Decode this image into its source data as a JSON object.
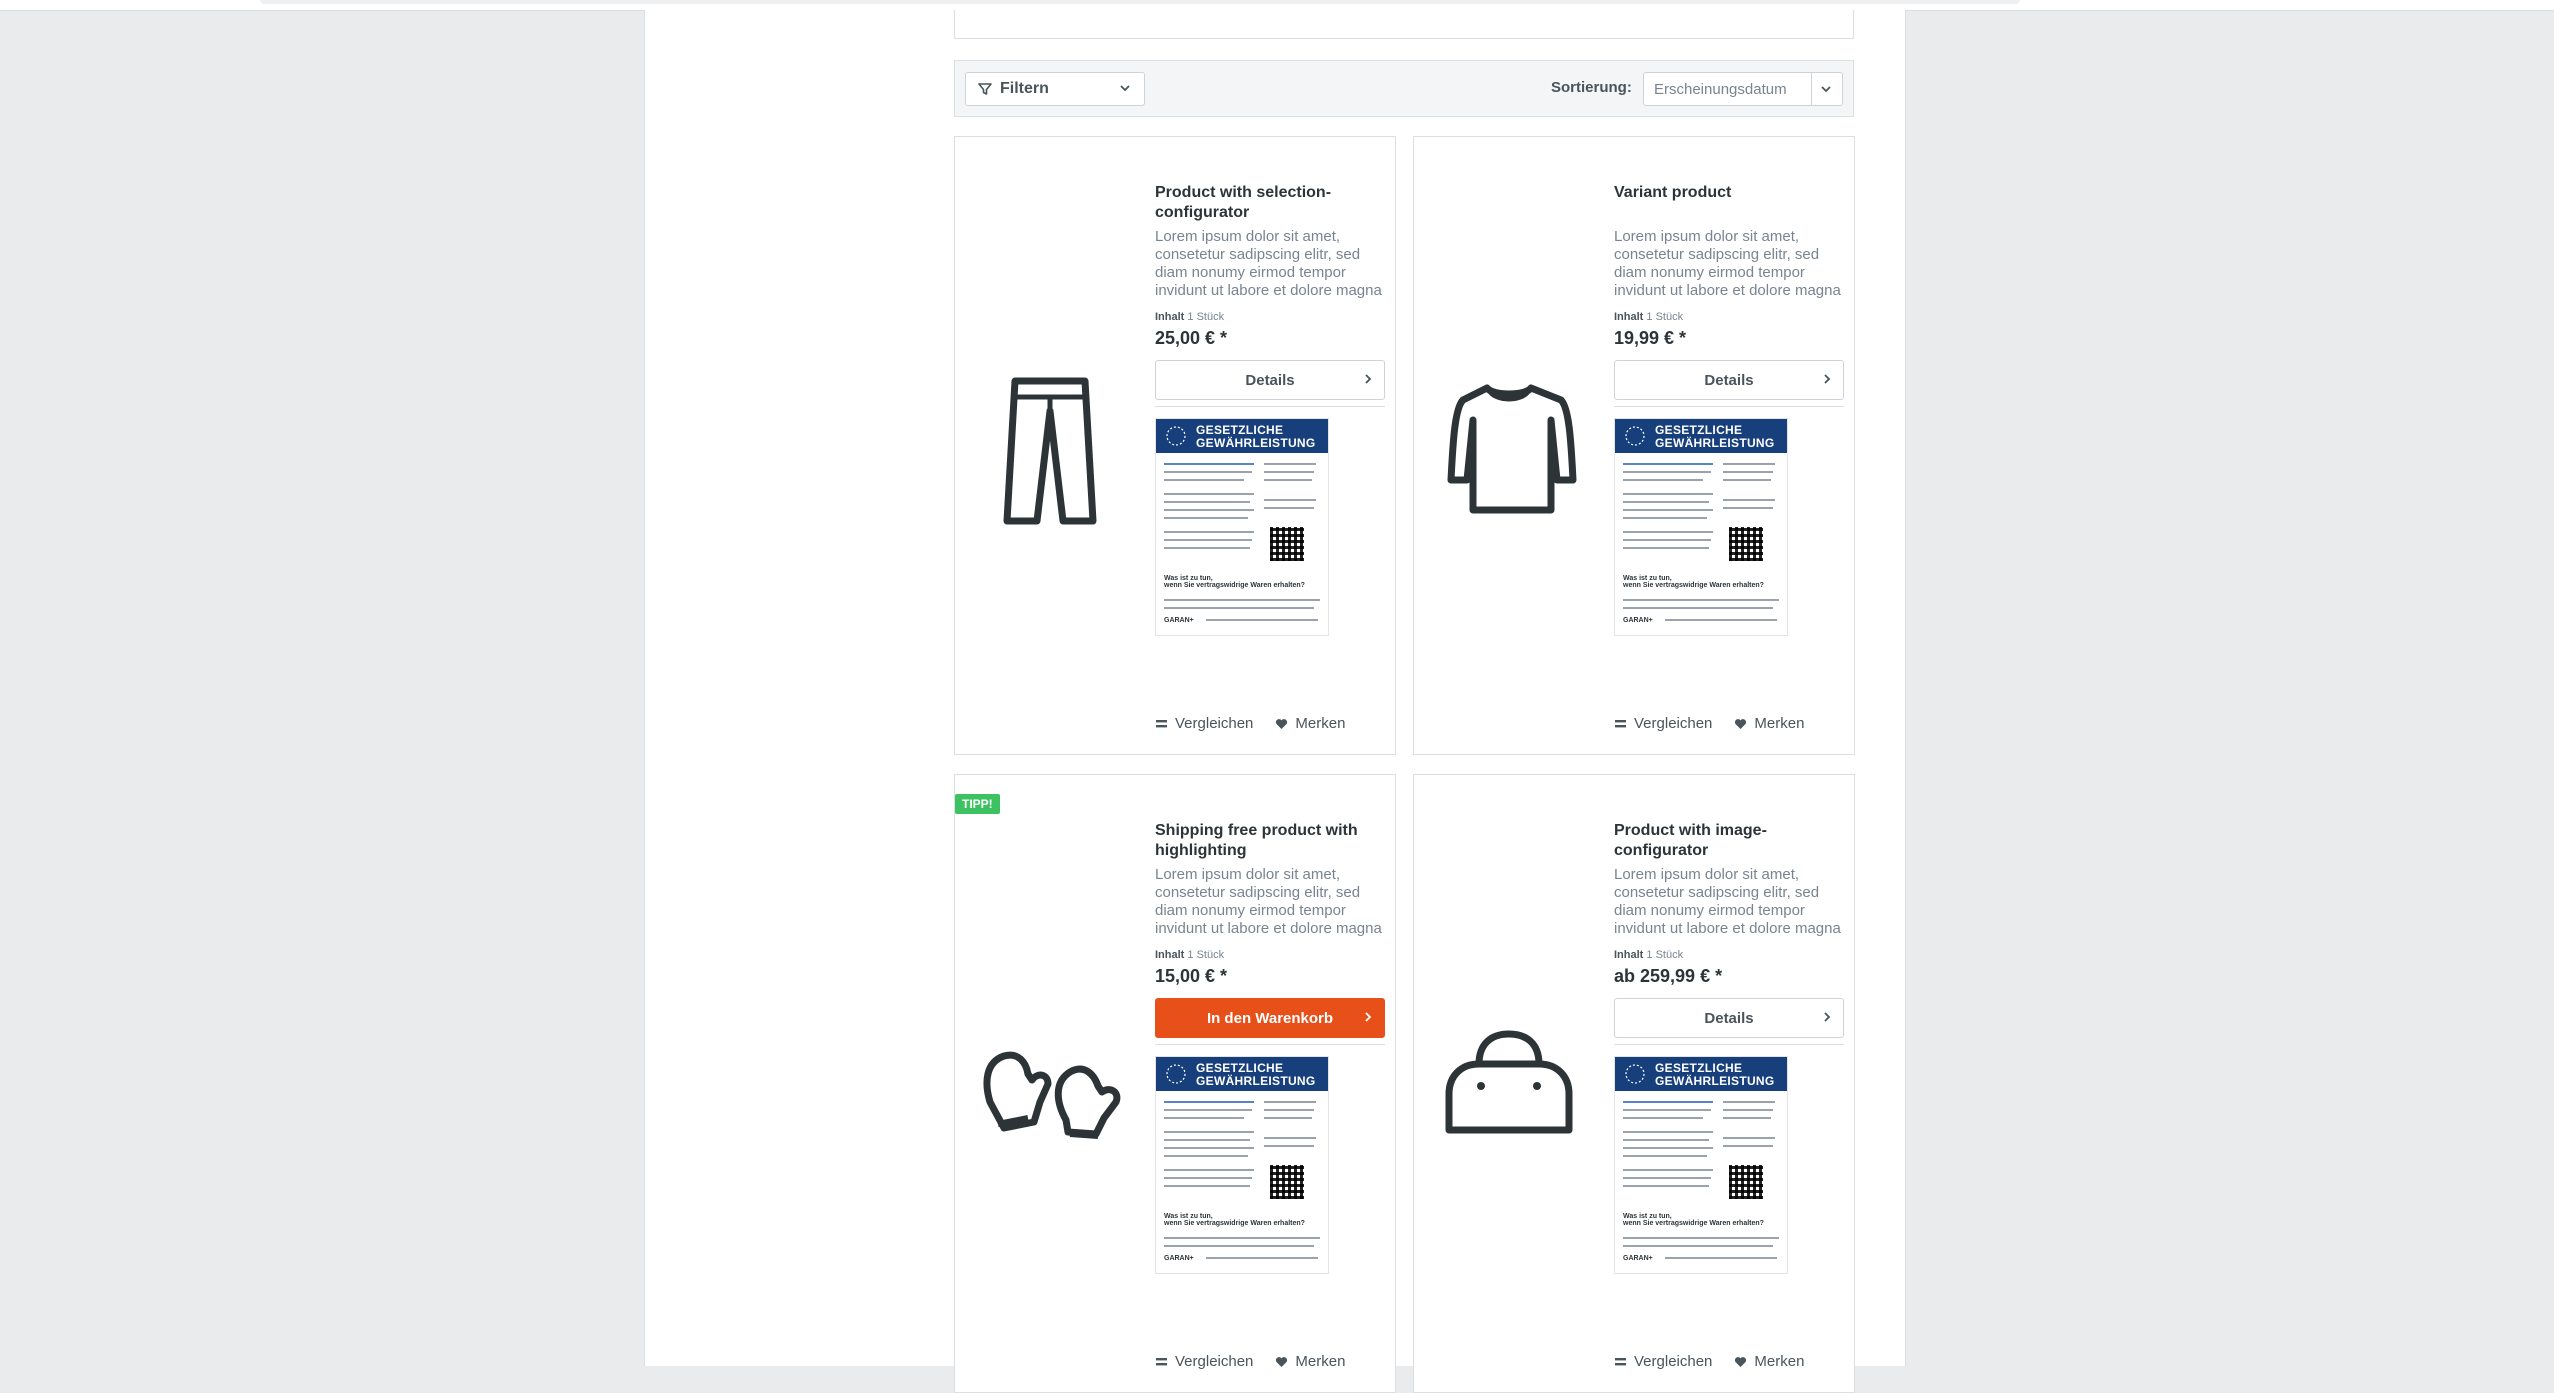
{
  "toolbar": {
    "filter_label": "Filtern",
    "sort_label": "Sortierung:",
    "sort_value": "Erscheinungsdatum"
  },
  "colors": {
    "primary": "#e8501a",
    "tip": "#3cc261",
    "badge_blue": "#173f7c"
  },
  "badge": {
    "line1": "GESETZLICHE",
    "line2": "GEWÄHRLEISTUNG",
    "subhead1": "Was ist zu tun,",
    "subhead2": "wenn Sie vertragswidrige Waren erhalten?",
    "brand": "GARAN+"
  },
  "products": [
    {
      "title": "Product with selection-configurator",
      "description": "Lorem ipsum dolor sit amet, consetetur sadipscing elitr, sed diam nonumy eirmod tempor invidunt ut labore et dolore magna",
      "unit_label": "Inhalt",
      "unit_value": "1 Stück",
      "price": "25,00 € *",
      "button": "Details",
      "icon": "pants-icon",
      "compare": "Vergleichen",
      "wishlist": "Merken"
    },
    {
      "title": "Variant product",
      "description": "Lorem ipsum dolor sit amet, consetetur sadipscing elitr, sed diam nonumy eirmod tempor invidunt ut labore et dolore magna",
      "unit_label": "Inhalt",
      "unit_value": "1 Stück",
      "price": "19,99 € *",
      "button": "Details",
      "icon": "sweater-icon",
      "compare": "Vergleichen",
      "wishlist": "Merken"
    },
    {
      "badge": "TIPP!",
      "title": "Shipping free product with highlighting",
      "description": "Lorem ipsum dolor sit amet, consetetur sadipscing elitr, sed diam nonumy eirmod tempor invidunt ut labore et dolore magna",
      "unit_label": "Inhalt",
      "unit_value": "1 Stück",
      "price": "15,00 € *",
      "button": "In den Warenkorb",
      "icon": "mittens-icon",
      "compare": "Vergleichen",
      "wishlist": "Merken"
    },
    {
      "title": "Product with image-configurator",
      "description": "Lorem ipsum dolor sit amet, consetetur sadipscing elitr, sed diam nonumy eirmod tempor invidunt ut labore et dolore magna",
      "unit_label": "Inhalt",
      "unit_value": "1 Stück",
      "price": "ab 259,99 € *",
      "button": "Details",
      "icon": "bag-icon",
      "compare": "Vergleichen",
      "wishlist": "Merken"
    }
  ]
}
